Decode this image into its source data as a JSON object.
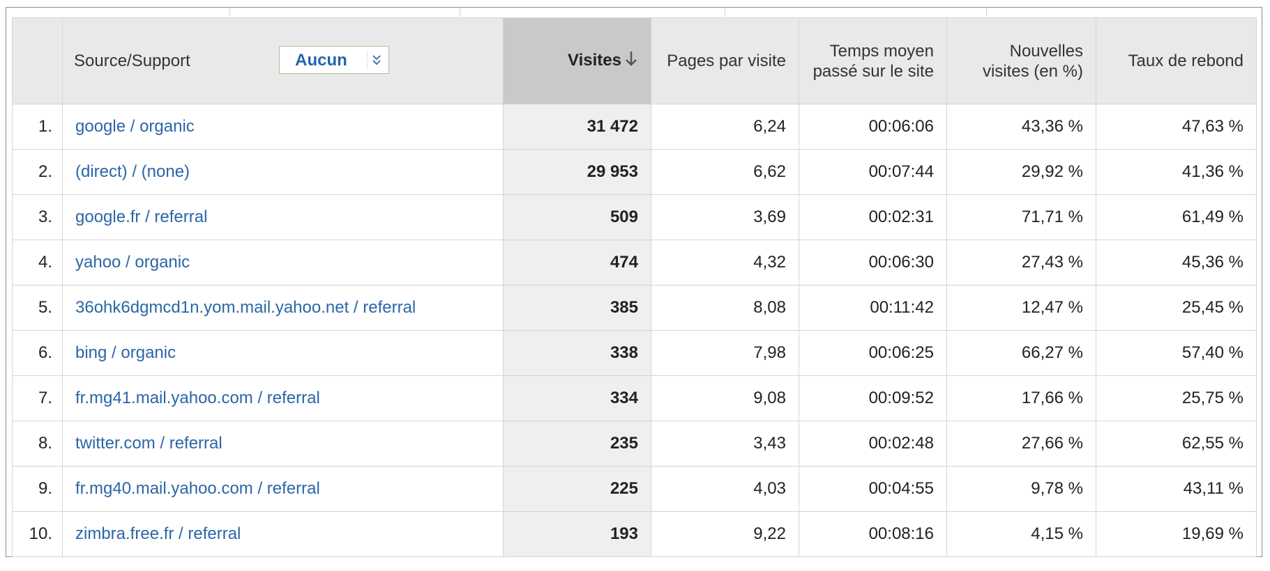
{
  "report": {
    "header": {
      "source_label": "Source/Support",
      "secondary_dimension": "Aucun",
      "visits": "Visites",
      "pages_per_visit": "Pages par visite",
      "avg_time": "Temps moyen passé sur le site",
      "new_visits": "Nouvelles visites (en %)",
      "bounce_rate": "Taux de rebond"
    },
    "rows": [
      {
        "idx": "1.",
        "source": "google / organic",
        "visits": "31 472",
        "pages": "6,24",
        "time": "00:06:06",
        "new": "43,36 %",
        "bounce": "47,63 %"
      },
      {
        "idx": "2.",
        "source": "(direct) / (none)",
        "visits": "29 953",
        "pages": "6,62",
        "time": "00:07:44",
        "new": "29,92 %",
        "bounce": "41,36 %"
      },
      {
        "idx": "3.",
        "source": "google.fr / referral",
        "visits": "509",
        "pages": "3,69",
        "time": "00:02:31",
        "new": "71,71 %",
        "bounce": "61,49 %"
      },
      {
        "idx": "4.",
        "source": "yahoo / organic",
        "visits": "474",
        "pages": "4,32",
        "time": "00:06:30",
        "new": "27,43 %",
        "bounce": "45,36 %"
      },
      {
        "idx": "5.",
        "source": "36ohk6dgmcd1n.yom.mail.yahoo.net / referral",
        "visits": "385",
        "pages": "8,08",
        "time": "00:11:42",
        "new": "12,47 %",
        "bounce": "25,45 %"
      },
      {
        "idx": "6.",
        "source": "bing / organic",
        "visits": "338",
        "pages": "7,98",
        "time": "00:06:25",
        "new": "66,27 %",
        "bounce": "57,40 %"
      },
      {
        "idx": "7.",
        "source": "fr.mg41.mail.yahoo.com / referral",
        "visits": "334",
        "pages": "9,08",
        "time": "00:09:52",
        "new": "17,66 %",
        "bounce": "25,75 %"
      },
      {
        "idx": "8.",
        "source": "twitter.com / referral",
        "visits": "235",
        "pages": "3,43",
        "time": "00:02:48",
        "new": "27,66 %",
        "bounce": "62,55 %"
      },
      {
        "idx": "9.",
        "source": "fr.mg40.mail.yahoo.com / referral",
        "visits": "225",
        "pages": "4,03",
        "time": "00:04:55",
        "new": "9,78 %",
        "bounce": "43,11 %"
      },
      {
        "idx": "10.",
        "source": "zimbra.free.fr / referral",
        "visits": "193",
        "pages": "9,22",
        "time": "00:08:16",
        "new": "4,15 %",
        "bounce": "19,69 %"
      }
    ]
  },
  "colors": {
    "link": "#2a66a8",
    "header_bg": "#e9e9e9",
    "sorted_header_bg": "#c9c9c9",
    "sorted_cell_bg": "#efefef",
    "border": "#d4d4d4"
  },
  "icons": {
    "sort": "arrow-down-icon",
    "dropdown": "chevron-double-down-icon"
  }
}
